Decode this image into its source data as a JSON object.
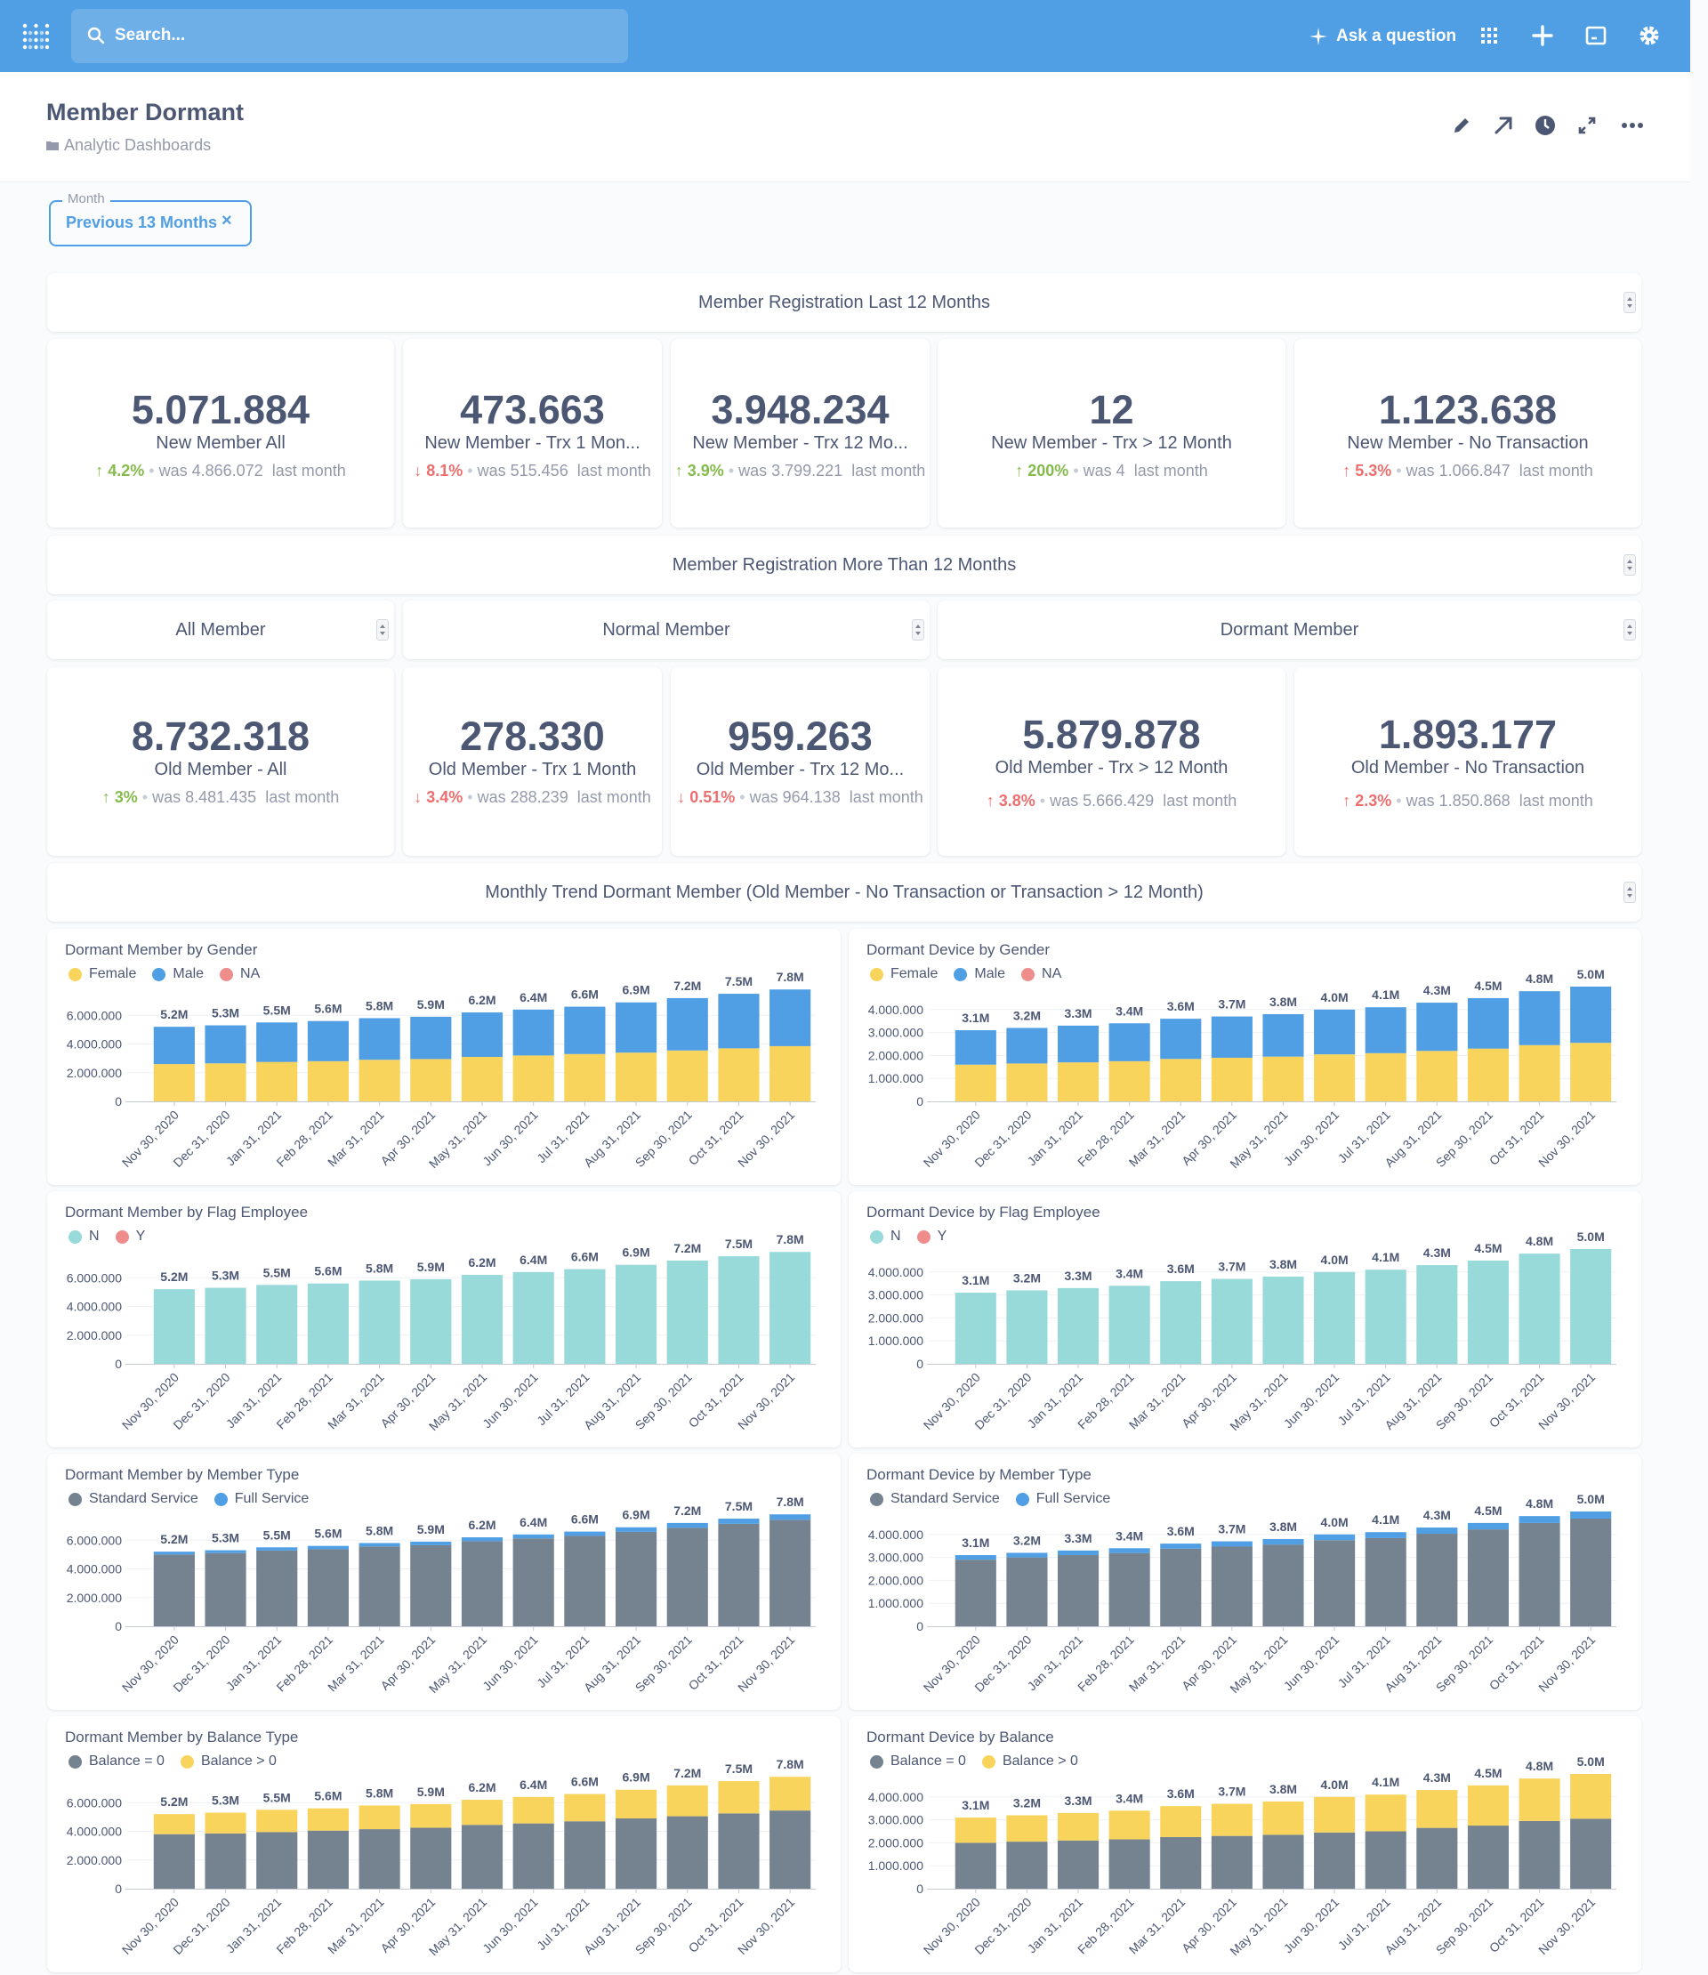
{
  "nav": {
    "search_placeholder": "Search...",
    "ask_label": "Ask a question"
  },
  "header": {
    "title": "Member Dormant",
    "collection": "Analytic Dashboards"
  },
  "filter": {
    "label": "Month",
    "value": "Previous 13 Months"
  },
  "sections": {
    "last12": "Member Registration Last 12 Months",
    "more12": "Member Registration More Than 12 Months",
    "all_member": "All Member",
    "normal_member": "Normal Member",
    "dormant_member": "Dormant Member",
    "trend": "Monthly Trend Dormant Member (Old Member - No Transaction or Transaction > 12 Month)"
  },
  "scalars_new": [
    {
      "value": "5.071.884",
      "label": "New Member All",
      "dir": "up",
      "pct": "4.2%",
      "was": "was 4.866.072",
      "period": "last month"
    },
    {
      "value": "473.663",
      "label": "New Member - Trx 1 Mon...",
      "dir": "down",
      "pct": "8.1%",
      "was": "was 515.456",
      "period": "last month"
    },
    {
      "value": "3.948.234",
      "label": "New Member - Trx 12 Mo...",
      "dir": "up",
      "pct": "3.9%",
      "was": "was 3.799.221",
      "period": "last month"
    },
    {
      "value": "12",
      "label": "New Member - Trx > 12 Month",
      "dir": "up",
      "pct": "200%",
      "was": "was 4",
      "period": "last month"
    },
    {
      "value": "1.123.638",
      "label": "New Member - No Transaction",
      "dir": "upbad",
      "pct": "5.3%",
      "was": "was 1.066.847",
      "period": "last month"
    }
  ],
  "scalars_old": [
    {
      "value": "8.732.318",
      "label": "Old Member - All",
      "dir": "up",
      "pct": "3%",
      "was": "was 8.481.435",
      "period": "last month"
    },
    {
      "value": "278.330",
      "label": "Old Member - Trx 1 Month",
      "dir": "down",
      "pct": "3.4%",
      "was": "was 288.239",
      "period": "last month"
    },
    {
      "value": "959.263",
      "label": "Old Member - Trx 12 Mo...",
      "dir": "down",
      "pct": "0.51%",
      "was": "was 964.138",
      "period": "last month"
    },
    {
      "value": "5.879.878",
      "label": "Old Member - Trx > 12 Month",
      "dir": "upbad",
      "pct": "3.8%",
      "was": "was 5.666.429",
      "period": "last month"
    },
    {
      "value": "1.893.177",
      "label": "Old Member - No Transaction",
      "dir": "upbad",
      "pct": "2.3%",
      "was": "was 1.850.868",
      "period": "last month"
    }
  ],
  "colors": {
    "yellow": "#f9d45c",
    "blue": "#509ee3",
    "red": "#ef8c8c",
    "teal": "#98d9d9",
    "gray": "#74838f"
  },
  "chart_data": [
    {
      "type": "bar",
      "stacked": true,
      "title": "Dormant Member by Gender",
      "categories": [
        "Nov 30, 2020",
        "Dec 31, 2020",
        "Jan 31, 2021",
        "Feb 28, 2021",
        "Mar 31, 2021",
        "Apr 30, 2021",
        "May 31, 2021",
        "Jun 30, 2021",
        "Jul 31, 2021",
        "Aug 31, 2021",
        "Sep 30, 2021",
        "Oct 31, 2021",
        "Nov 30, 2021"
      ],
      "totals_label": [
        "5.2M",
        "5.3M",
        "5.5M",
        "5.6M",
        "5.8M",
        "5.9M",
        "6.2M",
        "6.4M",
        "6.6M",
        "6.9M",
        "7.2M",
        "7.5M",
        "7.8M"
      ],
      "ylim": [
        0,
        8000000
      ],
      "yticks": [
        "0",
        "2.000.000",
        "4.000.000",
        "6.000.000"
      ],
      "ytick_values": [
        0,
        2000000,
        4000000,
        6000000
      ],
      "series": [
        {
          "name": "Female",
          "color": "#f9d45c",
          "values": [
            2600000,
            2650000,
            2750000,
            2800000,
            2900000,
            2950000,
            3100000,
            3200000,
            3300000,
            3400000,
            3550000,
            3700000,
            3850000
          ]
        },
        {
          "name": "Male",
          "color": "#509ee3",
          "values": [
            2600000,
            2650000,
            2750000,
            2800000,
            2900000,
            2950000,
            3100000,
            3200000,
            3300000,
            3500000,
            3650000,
            3800000,
            3950000
          ]
        },
        {
          "name": "NA",
          "color": "#ef8c8c",
          "values": [
            0,
            0,
            0,
            0,
            0,
            0,
            0,
            0,
            0,
            0,
            0,
            0,
            0
          ]
        }
      ]
    },
    {
      "type": "bar",
      "stacked": true,
      "title": "Dormant Device by Gender",
      "categories": [
        "Nov 30, 2020",
        "Dec 31, 2020",
        "Jan 31, 2021",
        "Feb 28, 2021",
        "Mar 31, 2021",
        "Apr 30, 2021",
        "May 31, 2021",
        "Jun 30, 2021",
        "Jul 31, 2021",
        "Aug 31, 2021",
        "Sep 30, 2021",
        "Oct 31, 2021",
        "Nov 30, 2021"
      ],
      "totals_label": [
        "3.1M",
        "3.2M",
        "3.3M",
        "3.4M",
        "3.6M",
        "3.7M",
        "3.8M",
        "4.0M",
        "4.1M",
        "4.3M",
        "4.5M",
        "4.8M",
        "5.0M"
      ],
      "ylim": [
        0,
        5000000
      ],
      "yticks": [
        "0",
        "1.000.000",
        "2.000.000",
        "3.000.000",
        "4.000.000"
      ],
      "ytick_values": [
        0,
        1000000,
        2000000,
        3000000,
        4000000
      ],
      "series": [
        {
          "name": "Female",
          "color": "#f9d45c",
          "values": [
            1600000,
            1650000,
            1700000,
            1750000,
            1850000,
            1900000,
            1950000,
            2050000,
            2100000,
            2200000,
            2300000,
            2450000,
            2550000
          ]
        },
        {
          "name": "Male",
          "color": "#509ee3",
          "values": [
            1500000,
            1550000,
            1600000,
            1650000,
            1750000,
            1800000,
            1850000,
            1950000,
            2000000,
            2100000,
            2200000,
            2350000,
            2450000
          ]
        },
        {
          "name": "NA",
          "color": "#ef8c8c",
          "values": [
            0,
            0,
            0,
            0,
            0,
            0,
            0,
            0,
            0,
            0,
            0,
            0,
            0
          ]
        }
      ]
    },
    {
      "type": "bar",
      "stacked": true,
      "title": "Dormant Member by Flag Employee",
      "categories": [
        "Nov 30, 2020",
        "Dec 31, 2020",
        "Jan 31, 2021",
        "Feb 28, 2021",
        "Mar 31, 2021",
        "Apr 30, 2021",
        "May 31, 2021",
        "Jun 30, 2021",
        "Jul 31, 2021",
        "Aug 31, 2021",
        "Sep 30, 2021",
        "Oct 31, 2021",
        "Nov 30, 2021"
      ],
      "totals_label": [
        "5.2M",
        "5.3M",
        "5.5M",
        "5.6M",
        "5.8M",
        "5.9M",
        "6.2M",
        "6.4M",
        "6.6M",
        "6.9M",
        "7.2M",
        "7.5M",
        "7.8M"
      ],
      "ylim": [
        0,
        8000000
      ],
      "yticks": [
        "0",
        "2.000.000",
        "4.000.000",
        "6.000.000"
      ],
      "ytick_values": [
        0,
        2000000,
        4000000,
        6000000
      ],
      "series": [
        {
          "name": "N",
          "color": "#98d9d9",
          "values": [
            5200000,
            5300000,
            5500000,
            5600000,
            5800000,
            5900000,
            6200000,
            6400000,
            6600000,
            6900000,
            7200000,
            7500000,
            7800000
          ]
        },
        {
          "name": "Y",
          "color": "#ef8c8c",
          "values": [
            0,
            0,
            0,
            0,
            0,
            0,
            0,
            0,
            0,
            0,
            0,
            0,
            0
          ]
        }
      ]
    },
    {
      "type": "bar",
      "stacked": true,
      "title": "Dormant Device by Flag Employee",
      "categories": [
        "Nov 30, 2020",
        "Dec 31, 2020",
        "Jan 31, 2021",
        "Feb 28, 2021",
        "Mar 31, 2021",
        "Apr 30, 2021",
        "May 31, 2021",
        "Jun 30, 2021",
        "Jul 31, 2021",
        "Aug 31, 2021",
        "Sep 30, 2021",
        "Oct 31, 2021",
        "Nov 30, 2021"
      ],
      "totals_label": [
        "3.1M",
        "3.2M",
        "3.3M",
        "3.4M",
        "3.6M",
        "3.7M",
        "3.8M",
        "4.0M",
        "4.1M",
        "4.3M",
        "4.5M",
        "4.8M",
        "5.0M"
      ],
      "ylim": [
        0,
        5000000
      ],
      "yticks": [
        "0",
        "1.000.000",
        "2.000.000",
        "3.000.000",
        "4.000.000"
      ],
      "ytick_values": [
        0,
        1000000,
        2000000,
        3000000,
        4000000
      ],
      "series": [
        {
          "name": "N",
          "color": "#98d9d9",
          "values": [
            3100000,
            3200000,
            3300000,
            3400000,
            3600000,
            3700000,
            3800000,
            4000000,
            4100000,
            4300000,
            4500000,
            4800000,
            5000000
          ]
        },
        {
          "name": "Y",
          "color": "#ef8c8c",
          "values": [
            0,
            0,
            0,
            0,
            0,
            0,
            0,
            0,
            0,
            0,
            0,
            0,
            0
          ]
        }
      ]
    },
    {
      "type": "bar",
      "stacked": true,
      "title": "Dormant Member by Member Type",
      "categories": [
        "Nov 30, 2020",
        "Dec 31, 2020",
        "Jan 31, 2021",
        "Feb 28, 2021",
        "Mar 31, 2021",
        "Apr 30, 2021",
        "May 31, 2021",
        "Jun 30, 2021",
        "Jul 31, 2021",
        "Aug 31, 2021",
        "Sep 30, 2021",
        "Oct 31, 2021",
        "Nov 30, 2021"
      ],
      "totals_label": [
        "5.2M",
        "5.3M",
        "5.5M",
        "5.6M",
        "5.8M",
        "5.9M",
        "6.2M",
        "6.4M",
        "6.6M",
        "6.9M",
        "7.2M",
        "7.5M",
        "7.8M"
      ],
      "ylim": [
        0,
        8000000
      ],
      "yticks": [
        "0",
        "2.000.000",
        "4.000.000",
        "6.000.000"
      ],
      "ytick_values": [
        0,
        2000000,
        4000000,
        6000000
      ],
      "series": [
        {
          "name": "Standard Service",
          "color": "#74838f",
          "values": [
            5000000,
            5100000,
            5280000,
            5370000,
            5560000,
            5650000,
            5930000,
            6120000,
            6300000,
            6580000,
            6860000,
            7140000,
            7420000
          ]
        },
        {
          "name": "Full Service",
          "color": "#509ee3",
          "values": [
            200000,
            200000,
            220000,
            230000,
            240000,
            250000,
            270000,
            280000,
            300000,
            320000,
            340000,
            360000,
            380000
          ]
        }
      ]
    },
    {
      "type": "bar",
      "stacked": true,
      "title": "Dormant Device by Member Type",
      "categories": [
        "Nov 30, 2020",
        "Dec 31, 2020",
        "Jan 31, 2021",
        "Feb 28, 2021",
        "Mar 31, 2021",
        "Apr 30, 2021",
        "May 31, 2021",
        "Jun 30, 2021",
        "Jul 31, 2021",
        "Aug 31, 2021",
        "Sep 30, 2021",
        "Oct 31, 2021",
        "Nov 30, 2021"
      ],
      "totals_label": [
        "3.1M",
        "3.2M",
        "3.3M",
        "3.4M",
        "3.6M",
        "3.7M",
        "3.8M",
        "4.0M",
        "4.1M",
        "4.3M",
        "4.5M",
        "4.8M",
        "5.0M"
      ],
      "ylim": [
        0,
        5000000
      ],
      "yticks": [
        "0",
        "1.000.000",
        "2.000.000",
        "3.000.000",
        "4.000.000"
      ],
      "ytick_values": [
        0,
        1000000,
        2000000,
        3000000,
        4000000
      ],
      "series": [
        {
          "name": "Standard Service",
          "color": "#74838f",
          "values": [
            2900000,
            3000000,
            3100000,
            3190000,
            3380000,
            3470000,
            3560000,
            3750000,
            3840000,
            4030000,
            4220000,
            4500000,
            4690000
          ]
        },
        {
          "name": "Full Service",
          "color": "#509ee3",
          "values": [
            200000,
            200000,
            200000,
            210000,
            220000,
            230000,
            240000,
            250000,
            260000,
            270000,
            280000,
            300000,
            310000
          ]
        }
      ]
    },
    {
      "type": "bar",
      "stacked": true,
      "title": "Dormant Member by Balance Type",
      "categories": [
        "Nov 30, 2020",
        "Dec 31, 2020",
        "Jan 31, 2021",
        "Feb 28, 2021",
        "Mar 31, 2021",
        "Apr 30, 2021",
        "May 31, 2021",
        "Jun 30, 2021",
        "Jul 31, 2021",
        "Aug 31, 2021",
        "Sep 30, 2021",
        "Oct 31, 2021",
        "Nov 30, 2021"
      ],
      "totals_label": [
        "5.2M",
        "5.3M",
        "5.5M",
        "5.6M",
        "5.8M",
        "5.9M",
        "6.2M",
        "6.4M",
        "6.6M",
        "6.9M",
        "7.2M",
        "7.5M",
        "7.8M"
      ],
      "ylim": [
        0,
        8000000
      ],
      "yticks": [
        "0",
        "2.000.000",
        "4.000.000",
        "6.000.000"
      ],
      "ytick_values": [
        0,
        2000000,
        4000000,
        6000000
      ],
      "series": [
        {
          "name": "Balance = 0",
          "color": "#74838f",
          "values": [
            3800000,
            3850000,
            3950000,
            4050000,
            4150000,
            4250000,
            4450000,
            4550000,
            4700000,
            4900000,
            5050000,
            5250000,
            5450000
          ]
        },
        {
          "name": "Balance > 0",
          "color": "#f9d45c",
          "values": [
            1400000,
            1450000,
            1550000,
            1550000,
            1650000,
            1650000,
            1750000,
            1850000,
            1900000,
            2000000,
            2150000,
            2250000,
            2350000
          ]
        }
      ]
    },
    {
      "type": "bar",
      "stacked": true,
      "title": "Dormant Device by Balance",
      "categories": [
        "Nov 30, 2020",
        "Dec 31, 2020",
        "Jan 31, 2021",
        "Feb 28, 2021",
        "Mar 31, 2021",
        "Apr 30, 2021",
        "May 31, 2021",
        "Jun 30, 2021",
        "Jul 31, 2021",
        "Aug 31, 2021",
        "Sep 30, 2021",
        "Oct 31, 2021",
        "Nov 30, 2021"
      ],
      "totals_label": [
        "3.1M",
        "3.2M",
        "3.3M",
        "3.4M",
        "3.6M",
        "3.7M",
        "3.8M",
        "4.0M",
        "4.1M",
        "4.3M",
        "4.5M",
        "4.8M",
        "5.0M"
      ],
      "ylim": [
        0,
        5000000
      ],
      "yticks": [
        "0",
        "1.000.000",
        "2.000.000",
        "3.000.000",
        "4.000.000"
      ],
      "ytick_values": [
        0,
        1000000,
        2000000,
        3000000,
        4000000
      ],
      "series": [
        {
          "name": "Balance = 0",
          "color": "#74838f",
          "values": [
            2000000,
            2050000,
            2100000,
            2150000,
            2250000,
            2300000,
            2350000,
            2450000,
            2500000,
            2650000,
            2750000,
            2950000,
            3050000
          ]
        },
        {
          "name": "Balance > 0",
          "color": "#f9d45c",
          "values": [
            1100000,
            1150000,
            1200000,
            1250000,
            1350000,
            1400000,
            1450000,
            1550000,
            1600000,
            1650000,
            1750000,
            1850000,
            1950000
          ]
        }
      ]
    }
  ]
}
